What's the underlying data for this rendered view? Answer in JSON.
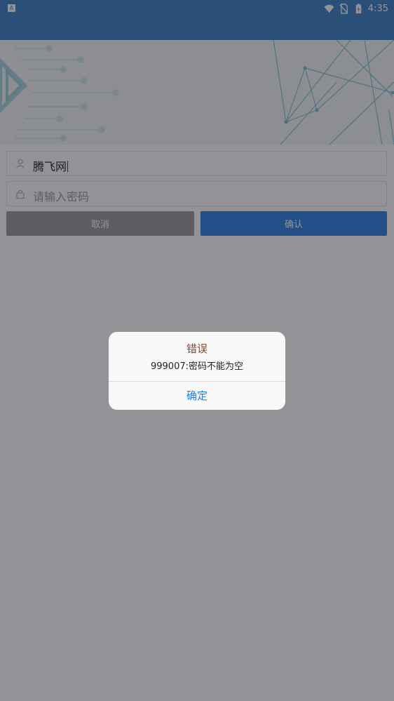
{
  "status_bar": {
    "notification_badge": "A",
    "time": "4:35",
    "icons": [
      "wifi-icon",
      "no-sim-icon",
      "battery-charging-icon"
    ]
  },
  "login_form": {
    "username_value": "腾飞网",
    "username_icon": "user-icon",
    "password_placeholder": "请输入密码",
    "password_icon": "lock-icon",
    "cancel_label": "取消",
    "confirm_label": "确认"
  },
  "dialog": {
    "title": "错误",
    "message": "999007:密码不能为空",
    "ok_label": "确定"
  },
  "colors": {
    "header_blue": "#3a7fc6",
    "confirm_blue": "#2a7fe0",
    "cancel_gray": "#9b9b9b",
    "dialog_link": "#1a7fd8"
  }
}
